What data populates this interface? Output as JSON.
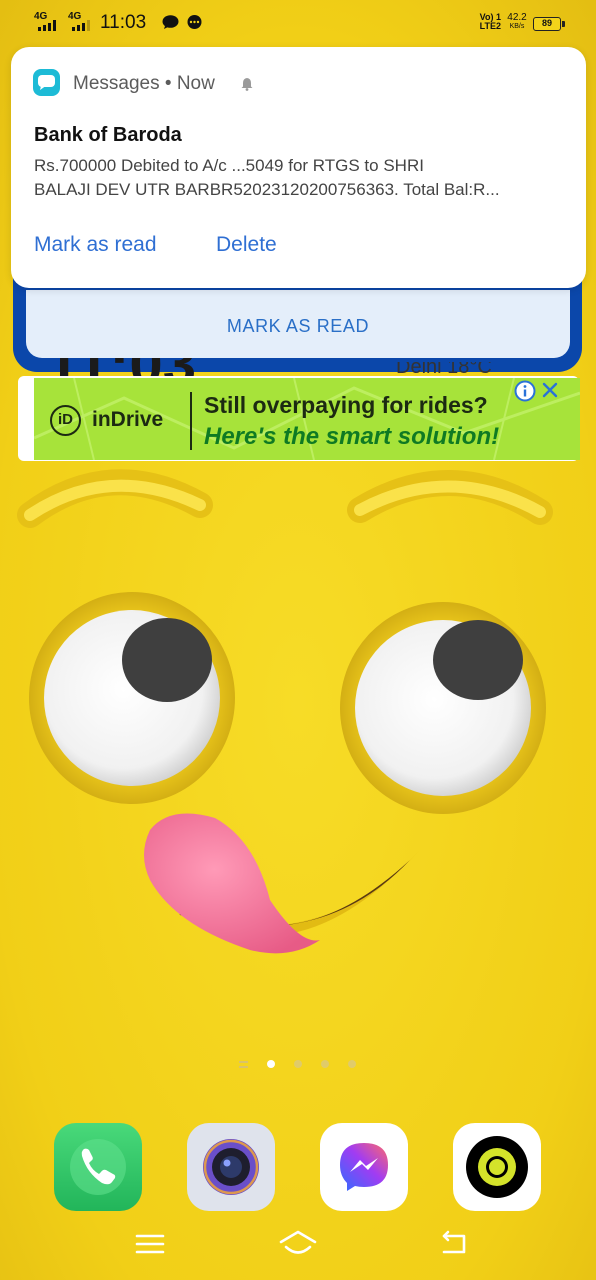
{
  "status_bar": {
    "network_1": "4G",
    "network_2": "4G",
    "time": "11:03",
    "volte_line1": "Vo) 1",
    "volte_line2": "LTE2",
    "speed_value": "42.2",
    "speed_unit": "KB/s",
    "battery": "89"
  },
  "notification": {
    "app_name": "Messages",
    "separator": "•",
    "time": "Now",
    "sender": "Bank of Baroda",
    "message_line1": "Rs.700000 Debited to A/c ...5049 for RTGS to SHRI",
    "message_line2": "BALAJI DEV UTR BARBR52023120200756363. Total Bal:R...",
    "action_mark_read": "Mark as read",
    "action_delete": "Delete",
    "accent_color": "#2f6fd3",
    "icon_color": "#1dbbd6"
  },
  "widget": {
    "mark_as_read": "MARK AS READ",
    "clock_partial": "11:03",
    "weather_partial": "Delhi 18°C"
  },
  "ad": {
    "brand": "inDrive",
    "logo_text": "iD",
    "headline": "Still overpaying for rides?",
    "subline": "Here's the smart solution!",
    "background_color": "#a7e33a"
  },
  "home": {
    "page_count": 4,
    "active_page": 1,
    "dock": [
      {
        "icon": "phone-icon"
      },
      {
        "icon": "camera-icon"
      },
      {
        "icon": "messenger-icon"
      },
      {
        "icon": "ola-icon"
      }
    ]
  },
  "nav_bar": {
    "buttons": [
      "menu-icon",
      "home-icon",
      "back-icon"
    ]
  }
}
